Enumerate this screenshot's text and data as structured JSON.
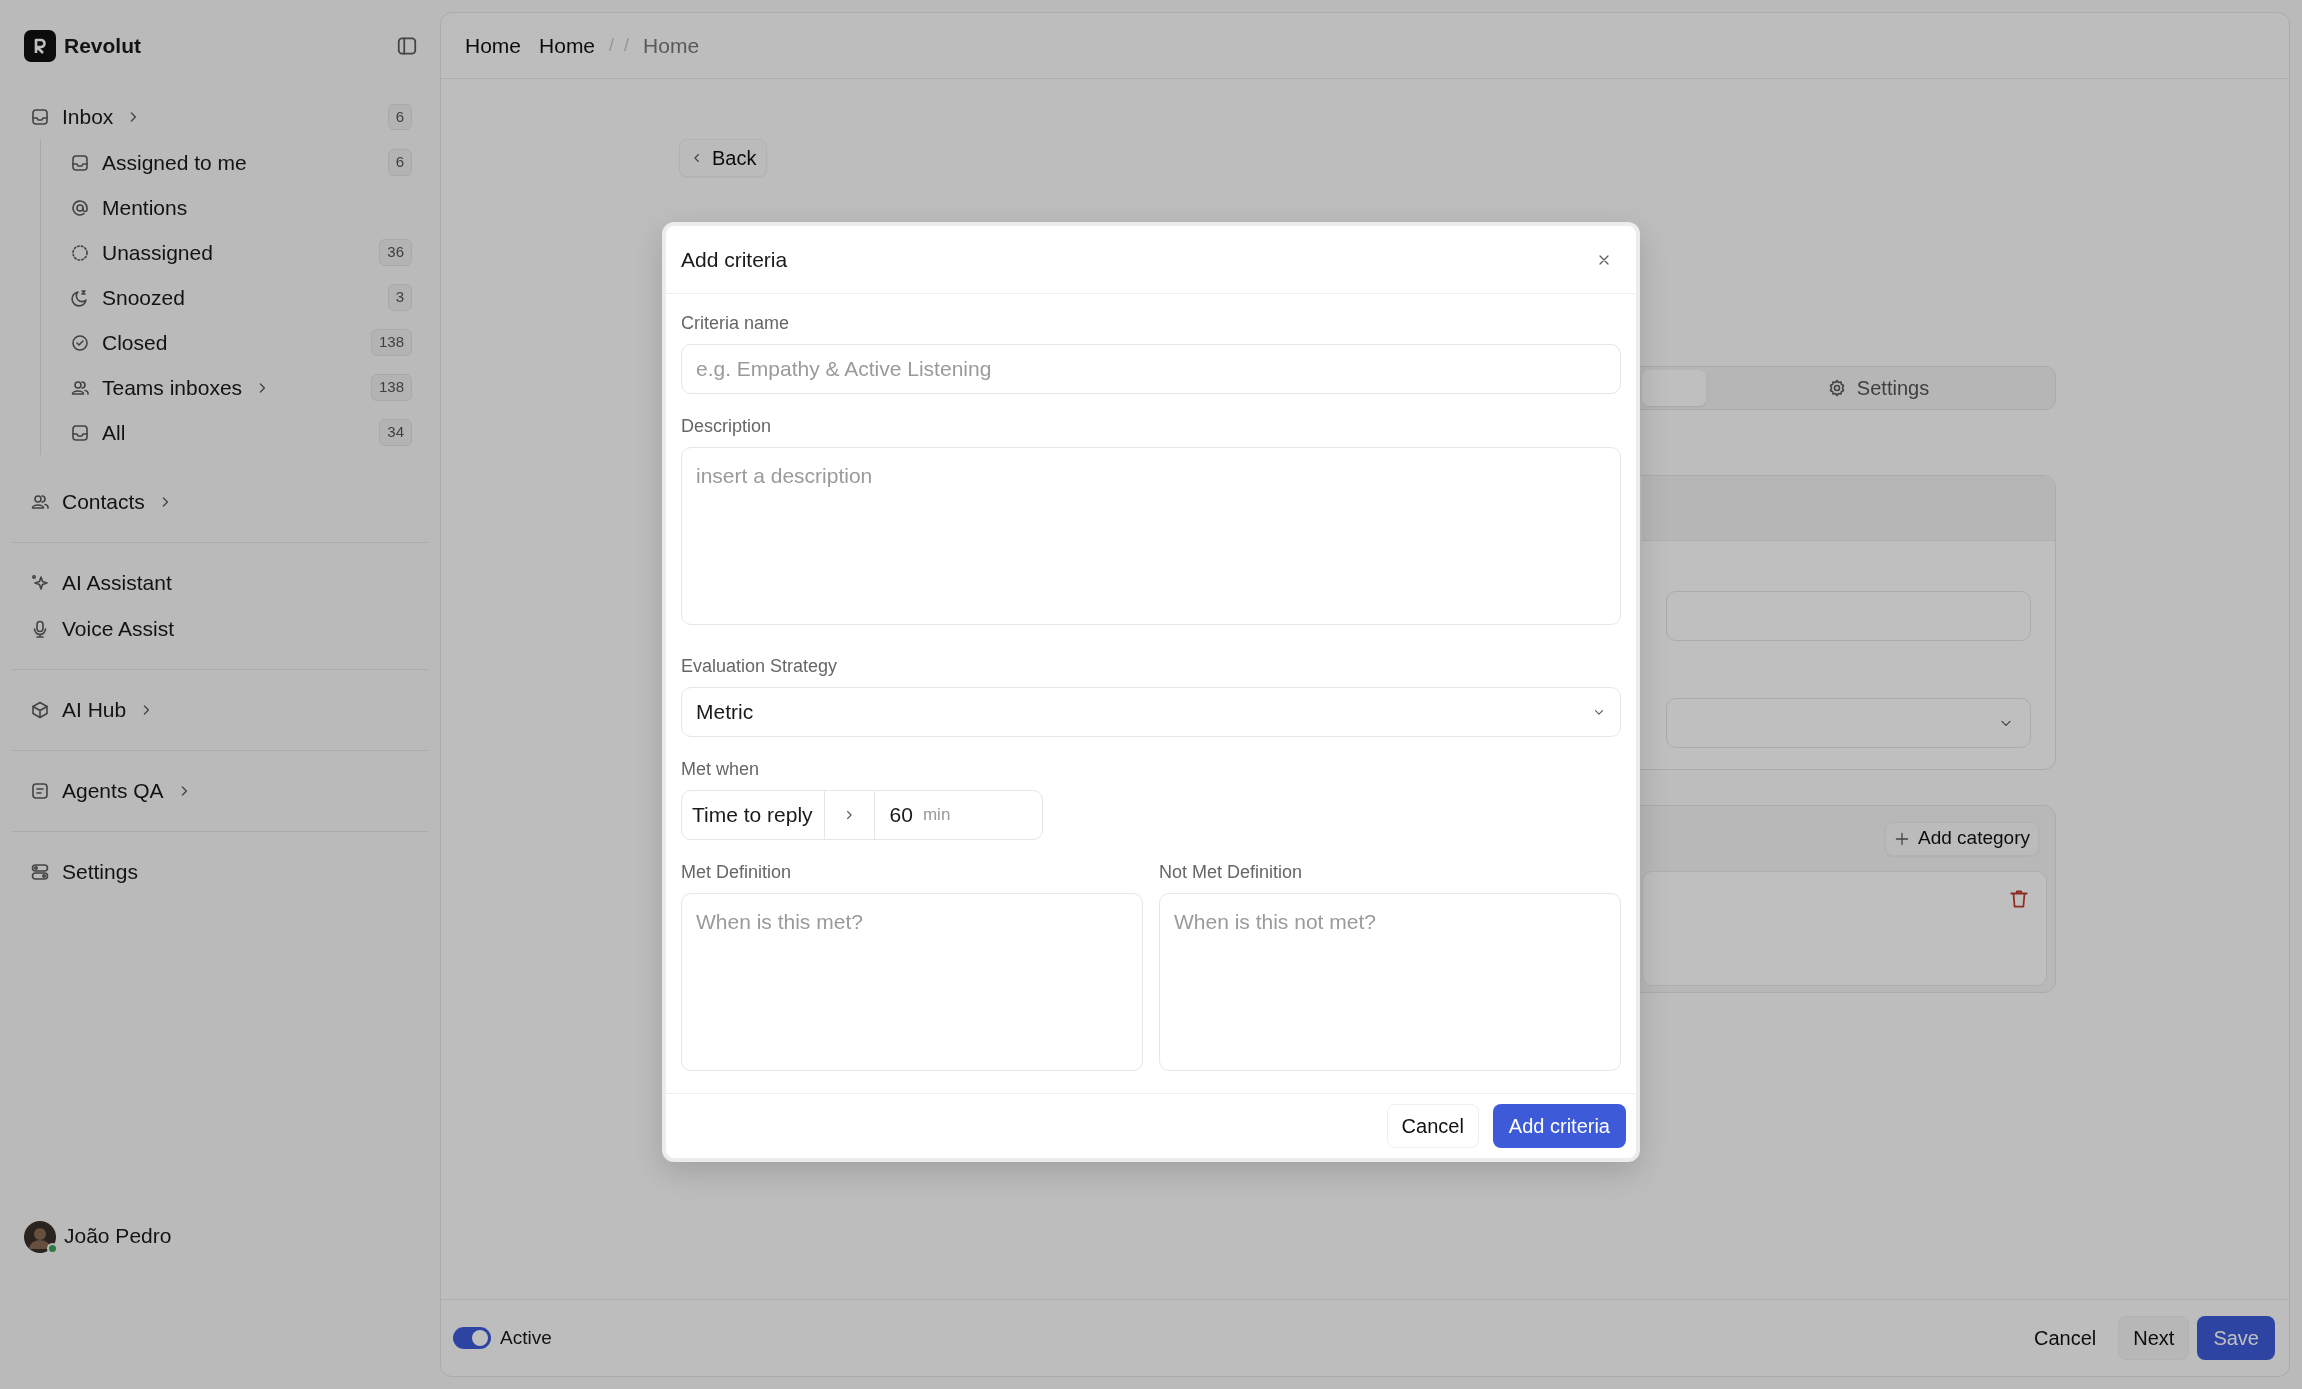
{
  "sidebar": {
    "brand": "Revolut",
    "groups": [
      [
        {
          "label": "Inbox",
          "chevron": true,
          "count": "6",
          "children": [
            {
              "label": "Assigned to me",
              "chevron": false,
              "count": "6"
            },
            {
              "label": "Mentions",
              "chevron": false
            },
            {
              "label": "Unassigned",
              "chevron": false,
              "count": "36"
            },
            {
              "label": "Snoozed",
              "chevron": false,
              "count": "3"
            },
            {
              "label": "Closed",
              "chevron": false,
              "count": "138"
            },
            {
              "label": "Teams inboxes",
              "chevron": true,
              "count": "138"
            },
            {
              "label": "All",
              "chevron": false,
              "count": "34"
            }
          ]
        },
        {
          "label": "Contacts",
          "chevron": true
        }
      ],
      [
        {
          "label": "AI Assistant",
          "chevron": false
        },
        {
          "label": "Voice Assist",
          "chevron": false
        }
      ],
      [
        {
          "label": "AI Hub",
          "chevron": true
        }
      ],
      [
        {
          "label": "Agents QA",
          "chevron": true
        }
      ],
      [
        {
          "label": "Settings",
          "chevron": false
        }
      ]
    ],
    "user": {
      "name": "João Pedro",
      "online": true
    }
  },
  "breadcrumb": [
    {
      "label": "Home",
      "kind": "link"
    },
    {
      "label": "Home",
      "kind": "link"
    },
    {
      "label": "/",
      "kind": "separator"
    },
    {
      "label": "/",
      "kind": "separator"
    },
    {
      "label": "Home",
      "kind": "current"
    }
  ],
  "page": {
    "back_button": "Back",
    "tabs": [
      {
        "selected": true
      },
      {
        "label": "Settings",
        "selected": false
      }
    ],
    "add_category_button": "Add category"
  },
  "footer": {
    "active_toggle": {
      "label": "Active",
      "on": true
    },
    "buttons": [
      {
        "label": "Cancel",
        "kind": "ghost"
      },
      {
        "label": "Next",
        "kind": "secondary"
      },
      {
        "label": "Save",
        "kind": "primary"
      }
    ]
  },
  "modal": {
    "title": "Add criteria",
    "criteria_name": {
      "label": "Criteria name",
      "placeholder": "e.g. Empathy & Active Listening"
    },
    "description": {
      "label": "Description",
      "placeholder": "insert a description"
    },
    "evaluation_strategy": {
      "label": "Evaluation Strategy",
      "value": "Metric"
    },
    "met_when": {
      "label": "Met when",
      "condition": "Time to reply",
      "value": "60",
      "unit": "min"
    },
    "met_definition": {
      "label": "Met Definition",
      "placeholder": "When is this met?"
    },
    "not_met_definition": {
      "label": "Not Met Definition",
      "placeholder": "When is this not met?"
    },
    "buttons": [
      {
        "label": "Cancel",
        "kind": "secondary"
      },
      {
        "label": "Add criteria",
        "kind": "primary"
      }
    ]
  }
}
